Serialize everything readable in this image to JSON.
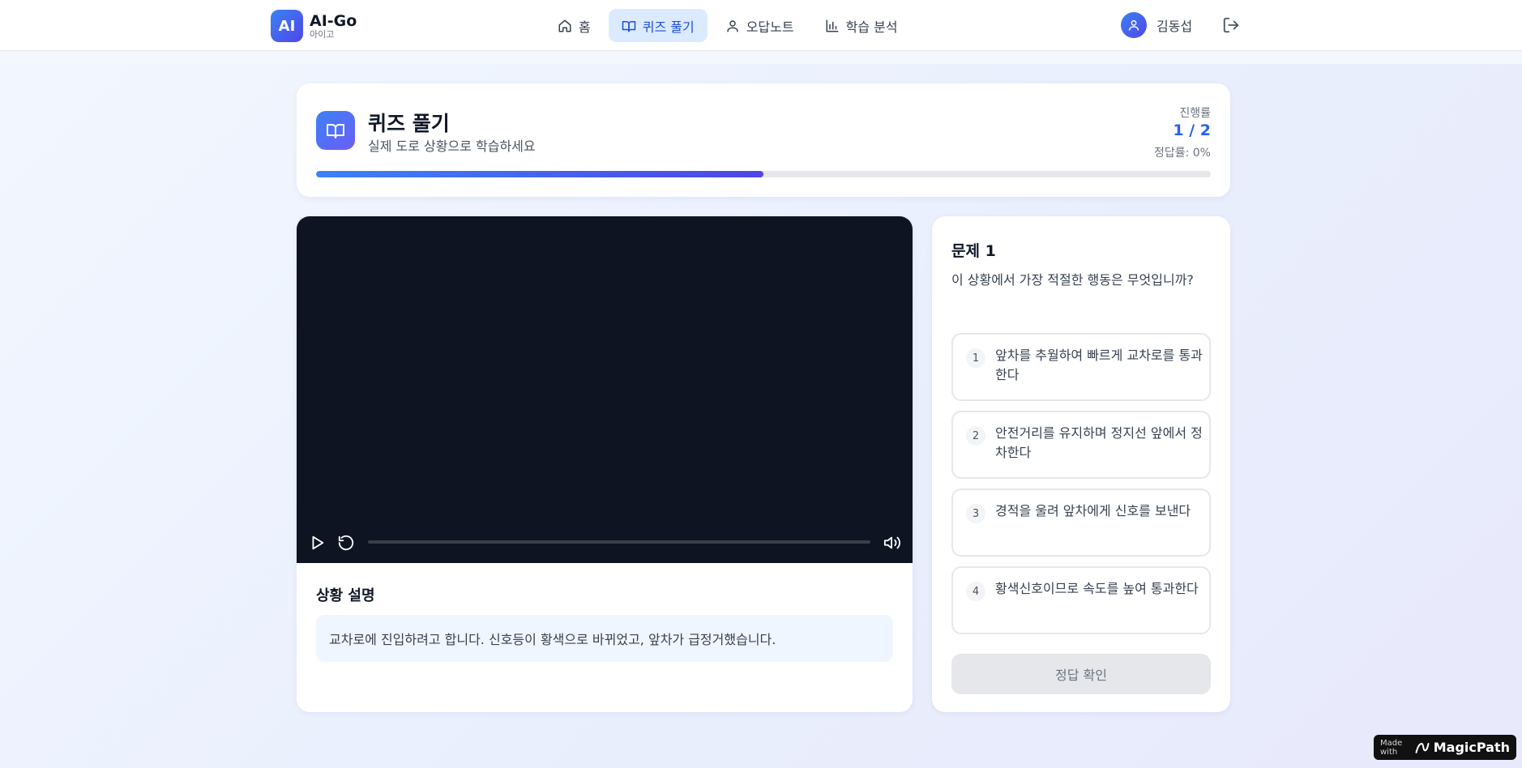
{
  "brand": {
    "logo": "AI",
    "name": "AI-Go",
    "subtitle": "아이고"
  },
  "nav": [
    {
      "label": "홈",
      "icon": "home-icon"
    },
    {
      "label": "퀴즈 풀기",
      "icon": "book-icon",
      "active": true
    },
    {
      "label": "오답노트",
      "icon": "user-icon"
    },
    {
      "label": "학습 분석",
      "icon": "bar-chart-icon"
    }
  ],
  "user": {
    "name": "김동섭"
  },
  "quiz_header": {
    "title": "퀴즈 풀기",
    "subtitle": "실제 도로 상황으로 학습하세요",
    "progress_label": "진행률",
    "progress_value": "1 / 2",
    "progress_fraction": 0.5,
    "accuracy": "정답률: 0%"
  },
  "situation": {
    "title": "상황 설명",
    "text": "교차로에 진입하려고 합니다. 신호등이 황색으로 바뀌었고, 앞차가 급정거했습니다."
  },
  "question": {
    "title": "문제 1",
    "text": "이 상황에서 가장 적절한 행동은 무엇입니까?",
    "options": [
      {
        "num": "1",
        "text": "앞차를 추월하여 빠르게 교차로를 통과한다"
      },
      {
        "num": "2",
        "text": "안전거리를 유지하며 정지선 앞에서 정차한다"
      },
      {
        "num": "3",
        "text": "경적을 울려 앞차에게 신호를 보낸다"
      },
      {
        "num": "4",
        "text": "황색신호이므로 속도를 높여 통과한다"
      }
    ],
    "submit_label": "정답 확인"
  },
  "badge": {
    "prefix": "Made with",
    "brand": "MagicPath"
  },
  "colors": {
    "accent": "#2563eb",
    "accent_end": "#4f46e5",
    "video_bg": "#0f1422"
  }
}
